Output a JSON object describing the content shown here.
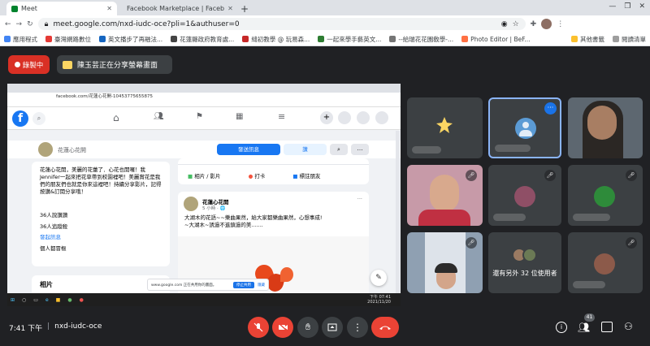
{
  "browser": {
    "tabs": [
      {
        "title": "Meet",
        "active": true
      },
      {
        "title": "Facebook Marketplace | Faceb",
        "active": false
      }
    ],
    "url": "meet.google.com/nxd-iudc-oce?pli=1&authuser=0",
    "bookmarks": [
      "應用程式",
      "臺灣網路數位",
      "英文播步了再融法...",
      "花蓮縣政府教育處...",
      "縫初教學 @ 玩易森...",
      "一起來學手藝英文...",
      "--給瑞花花園敎學-...",
      "Photo Editor | BeF...",
      "其他書籤",
      "閱讀清單"
    ]
  },
  "meet": {
    "recording_label": "錄製中",
    "presenting_text": "陳玉芸正在分享螢幕畫面",
    "time": "7:41 下午",
    "separator": "|",
    "meeting_code": "nxd-iudc-oce",
    "others_count_text": "還有另外 32 位使用者",
    "participants_badge": "41",
    "colors": {
      "end_call": "#ea4335",
      "mic_off": "#ea4335",
      "recording": "#d93025",
      "tile_bg": "#3c4043",
      "highlight": "#8ab4f8"
    },
    "icons": [
      "mic-off-icon",
      "camera-off-icon",
      "hand-icon",
      "present-icon",
      "more-icon",
      "end-call-icon",
      "info-icon",
      "people-icon",
      "chat-icon",
      "activities-icon"
    ]
  },
  "shared": {
    "url": "facebook.com/花蓮心花開-10453775655875",
    "page_name": "花蓮心花開",
    "send_msg": "發送訊息",
    "like": "讚",
    "menu": [
      "相片 / 影片",
      "打卡",
      "標註朋友"
    ],
    "about_text": "花蓮心花開，美麗的花蕾了．心花也開囉！我Jennifer一起來把花草帶到校園裡吧！美麗賞花是我們的朋友們也就是你來這裡吧！持續分享影片，記得按讚&訂閱分享哦！",
    "stats": [
      "36人說讚讚",
      "36人追蹤殺",
      "發起訊息",
      "個人都冒樞"
    ],
    "post_author": "花蓮心花開",
    "post_time": "5 小時 · 🌐",
    "post_text": "大湖木的花語~~樂曲果然，給大家都樂曲果然，心想事成!\n~大湖木~誘過不進鎮過的美.......",
    "photos_label": "相片",
    "share_notice": "www.google.com 正在共用你的畫面。",
    "share_stop": "停止共用",
    "share_hide": "隱藏",
    "clock": "下午 07:41",
    "date": "2021/11/20"
  }
}
